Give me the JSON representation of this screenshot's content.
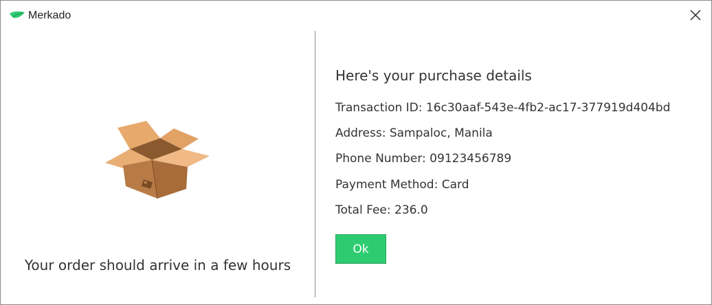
{
  "window": {
    "title": "Merkado",
    "app_icon": "merkado-leaf-icon",
    "close_icon": "close-icon"
  },
  "left": {
    "image_icon": "open-cardboard-box-icon",
    "arrival_message": "Your order should arrive in a few hours"
  },
  "details": {
    "heading": "Here's your purchase details",
    "transaction": "Transaction ID: 16c30aaf-543e-4fb2-ac17-377919d404bd",
    "address": "Address: Sampaloc, Manila",
    "phone": "Phone Number: 09123456789",
    "payment": "Payment Method: Card",
    "total": "Total Fee: 236.0"
  },
  "actions": {
    "ok_label": "Ok"
  },
  "colors": {
    "accent": "#2ecc71",
    "text": "#333333",
    "divider": "#8c8c8c"
  }
}
